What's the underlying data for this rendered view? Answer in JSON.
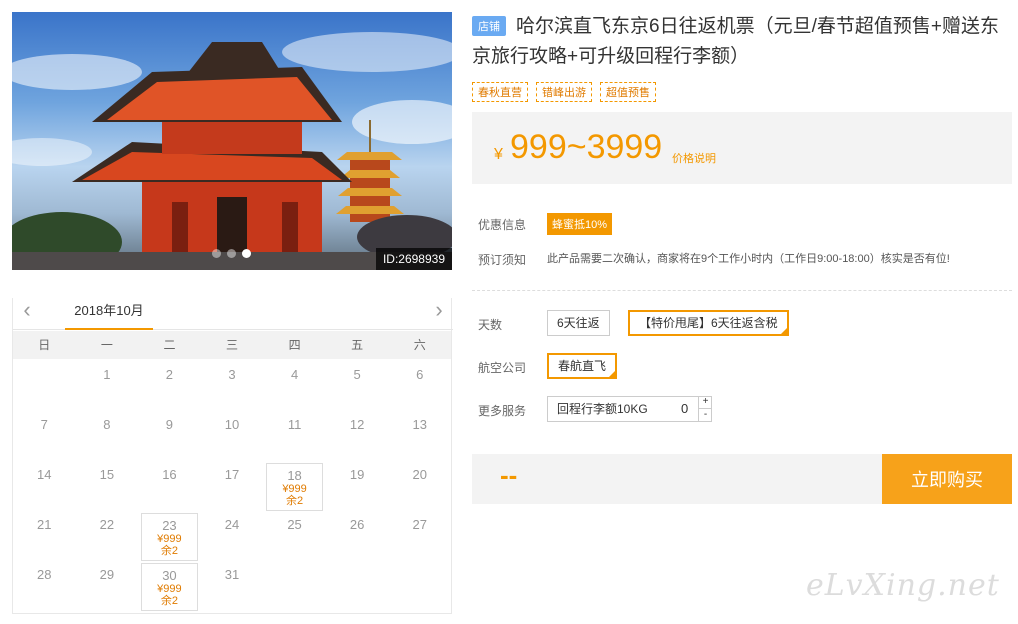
{
  "hero": {
    "image_id": "ID:2698939",
    "slide_count": 3,
    "active_slide": 3
  },
  "calendar": {
    "prev_icon": "chevron-left-icon",
    "next_icon": "chevron-right-icon",
    "month": "2018年10月",
    "weekdays": [
      "日",
      "一",
      "二",
      "三",
      "四",
      "五",
      "六"
    ],
    "leading_blanks": 1,
    "days": [
      {
        "d": "1"
      },
      {
        "d": "2"
      },
      {
        "d": "3"
      },
      {
        "d": "4"
      },
      {
        "d": "5"
      },
      {
        "d": "6"
      },
      {
        "d": "7"
      },
      {
        "d": "8"
      },
      {
        "d": "9"
      },
      {
        "d": "10"
      },
      {
        "d": "11"
      },
      {
        "d": "12"
      },
      {
        "d": "13"
      },
      {
        "d": "14"
      },
      {
        "d": "15"
      },
      {
        "d": "16"
      },
      {
        "d": "17"
      },
      {
        "d": "18",
        "price": "¥999",
        "rest": "余2"
      },
      {
        "d": "19"
      },
      {
        "d": "20"
      },
      {
        "d": "21"
      },
      {
        "d": "22"
      },
      {
        "d": "23",
        "price": "¥999",
        "rest": "余2"
      },
      {
        "d": "24"
      },
      {
        "d": "25"
      },
      {
        "d": "26"
      },
      {
        "d": "27"
      },
      {
        "d": "28"
      },
      {
        "d": "29"
      },
      {
        "d": "30",
        "price": "¥999",
        "rest": "余2"
      },
      {
        "d": "31"
      }
    ]
  },
  "product": {
    "shop_badge": "店铺",
    "title": "哈尔滨直飞东京6日往返机票（元旦/春节超值预售+赠送东京旅行攻略+可升级回程行李额）",
    "tags": [
      "春秋直营",
      "错峰出游",
      "超值预售"
    ],
    "currency": "¥",
    "price_range": "999~3999",
    "price_note": "价格说明"
  },
  "info": {
    "discount_label": "优惠信息",
    "discount_badge": "蜂蜜抵10%",
    "notice_label": "预订须知",
    "notice_text": "此产品需要二次确认，商家将在9个工作小时内（工作日9:00-18:00）核实是否有位!"
  },
  "options": {
    "days_label": "天数",
    "days_opt1": "6天往返",
    "days_opt2": "【特价甩尾】6天往返含税",
    "airline_label": "航空公司",
    "airline_opt": "春航直飞",
    "service_label": "更多服务",
    "service_name": "回程行李额10KG",
    "service_qty": "0",
    "plus": "+",
    "minus": "-"
  },
  "buy": {
    "total": "--",
    "button": "立即购买"
  },
  "watermark": "eLvXing.net",
  "colors": {
    "accent": "#f39800",
    "badge_blue": "#6aaaf2"
  }
}
